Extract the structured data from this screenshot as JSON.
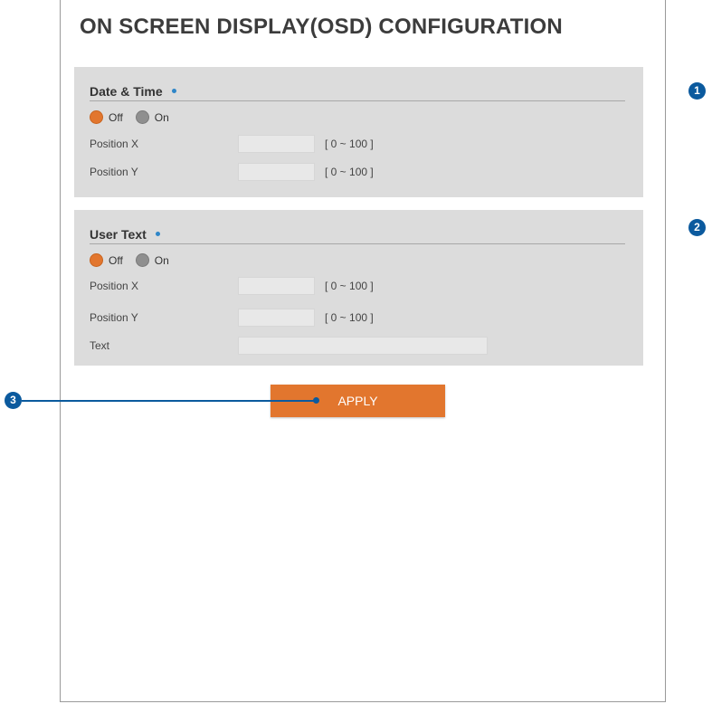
{
  "page": {
    "title": "ON SCREEN DISPLAY(OSD) CONFIGURATION"
  },
  "date_time": {
    "title": "Date & Time",
    "off_label": "Off",
    "on_label": "On",
    "selected": "Off",
    "position_x": {
      "label": "Position X",
      "value": "",
      "range": "[ 0 ~ 100 ]"
    },
    "position_y": {
      "label": "Position Y",
      "value": "",
      "range": "[ 0 ~ 100 ]"
    }
  },
  "user_text": {
    "title": "User Text",
    "off_label": "Off",
    "on_label": "On",
    "selected": "Off",
    "position_x": {
      "label": "Position X",
      "value": "",
      "range": "[ 0 ~ 100 ]"
    },
    "position_y": {
      "label": "Position Y",
      "value": "",
      "range": "[ 0 ~ 100 ]"
    },
    "text": {
      "label": "Text",
      "value": ""
    }
  },
  "apply_label": "APPLY",
  "callouts": [
    "1",
    "2",
    "3"
  ],
  "colors": {
    "accent": "#e2762e",
    "panel": "#dcdcdc",
    "callout": "#0b5a9e"
  }
}
